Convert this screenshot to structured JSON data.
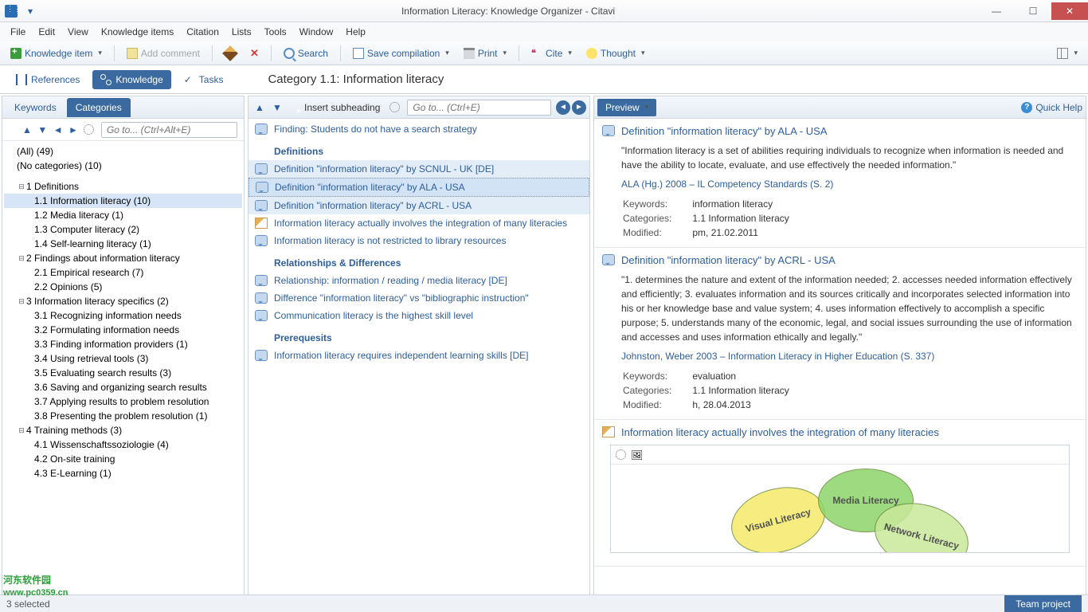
{
  "window": {
    "title": "Information Literacy: Knowledge Organizer - Citavi"
  },
  "menu": [
    "File",
    "Edit",
    "View",
    "Knowledge items",
    "Citation",
    "Lists",
    "Tools",
    "Window",
    "Help"
  ],
  "toolbar": {
    "knowledge_item": "Knowledge item",
    "add_comment": "Add comment",
    "search": "Search",
    "save_compilation": "Save compilation",
    "print": "Print",
    "cite": "Cite",
    "thought": "Thought"
  },
  "nav": {
    "references": "References",
    "knowledge": "Knowledge",
    "tasks": "Tasks",
    "crumb": "Category 1.1:  Information literacy"
  },
  "left": {
    "tabs": {
      "keywords": "Keywords",
      "categories": "Categories"
    },
    "goto_ph": "Go to... (Ctrl+Alt+E)",
    "all": "(All) (49)",
    "nocat": "(No categories) (10)",
    "tree": [
      {
        "lvl": 1,
        "tw": "⊟",
        "txt": "1 Definitions"
      },
      {
        "lvl": 2,
        "txt": "1.1 Information literacy (10)",
        "sel": true
      },
      {
        "lvl": 2,
        "txt": "1.2 Media literacy (1)"
      },
      {
        "lvl": 2,
        "txt": "1.3 Computer literacy (2)"
      },
      {
        "lvl": 2,
        "txt": "1.4 Self-learning literacy (1)"
      },
      {
        "lvl": 1,
        "tw": "⊟",
        "txt": "2 Findings about information literacy"
      },
      {
        "lvl": 2,
        "txt": "2.1 Empirical research (7)"
      },
      {
        "lvl": 2,
        "txt": "2.2 Opinions (5)"
      },
      {
        "lvl": 1,
        "tw": "⊟",
        "txt": "3 Information literacy specifics (2)"
      },
      {
        "lvl": 2,
        "txt": "3.1 Recognizing information needs"
      },
      {
        "lvl": 2,
        "txt": "3.2 Formulating information needs"
      },
      {
        "lvl": 2,
        "txt": "3.3 Finding information providers (1)"
      },
      {
        "lvl": 2,
        "txt": "3.4 Using retrieval tools (3)"
      },
      {
        "lvl": 2,
        "txt": "3.5 Evaluating search results (3)"
      },
      {
        "lvl": 2,
        "txt": "3.6 Saving and organizing search results"
      },
      {
        "lvl": 2,
        "txt": "3.7 Applying results to problem resolution"
      },
      {
        "lvl": 2,
        "txt": "3.8 Presenting the problem resolution (1)"
      },
      {
        "lvl": 1,
        "tw": "⊟",
        "txt": "4 Training methods (3)"
      },
      {
        "lvl": 2,
        "txt": "4.1 Wissenschaftssoziologie (4)"
      },
      {
        "lvl": 2,
        "txt": "4.2 On-site training"
      },
      {
        "lvl": 2,
        "txt": "4.3 E-Learning (1)"
      }
    ]
  },
  "mid": {
    "insert": "Insert subheading",
    "goto_ph": "Go to... (Ctrl+E)",
    "items": [
      {
        "ico": "quote",
        "txt": "Finding: Students do not have a search strategy"
      },
      {
        "head": "Definitions"
      },
      {
        "ico": "quote",
        "txt": "Definition \"information literacy\" by SCNUL - UK [DE]",
        "hl": true
      },
      {
        "ico": "quote",
        "txt": "Definition \"information literacy\" by ALA - USA",
        "sel": true
      },
      {
        "ico": "quote",
        "txt": "Definition \"information literacy\" by ACRL - USA",
        "hl": true
      },
      {
        "ico": "pen",
        "txt": "Information literacy actually involves the integration of many literacies"
      },
      {
        "ico": "quote",
        "txt": "Information literacy is not restricted to library resources"
      },
      {
        "head": "Relationships & Differences"
      },
      {
        "ico": "quote",
        "txt": "Relationship: information / reading / media literacy [DE]"
      },
      {
        "ico": "quote",
        "txt": "Difference \"information literacy\" vs \"bibliographic instruction\""
      },
      {
        "ico": "quote",
        "txt": "Communication literacy is the highest skill level"
      },
      {
        "head": "Prerequesits"
      },
      {
        "ico": "quote",
        "txt": "Information literacy requires independent learning skills [DE]"
      }
    ]
  },
  "right": {
    "preview": "Preview",
    "quickhelp": "Quick Help",
    "blocks": [
      {
        "ico": "quote",
        "title": "Definition \"information literacy\" by ALA - USA",
        "body": "\"Information literacy is a set of abilities requiring individuals to recognize when information is needed and have the ability to locate, evaluate, and use effectively the needed information.\"",
        "cite": "ALA (Hg.) 2008 – IL Competency Standards (S. 2)",
        "meta": [
          [
            "Keywords:",
            "information literacy"
          ],
          [
            "Categories:",
            "1.1 Information literacy"
          ],
          [
            "Modified:",
            "pm, 21.02.2011"
          ]
        ]
      },
      {
        "ico": "quote",
        "title": "Definition \"information literacy\" by ACRL - USA",
        "body": "\"1. determines the nature and extent of the information needed;\n2. accesses needed information effectively and efficiently;\n3. evaluates information and its sources critically and incorporates selected information into his or her knowledge base and value system;\n4. uses information effectively to accomplish a specific purpose;\n5. understands many of the economic, legal, and social issues surrounding the use of information and accesses and uses information ethically and legally.\"",
        "cite": "Johnston, Weber 2003 – Information Literacy in Higher Education (S. 337)",
        "meta": [
          [
            "Keywords:",
            "evaluation"
          ],
          [
            "Categories:",
            "1.1 Information literacy"
          ],
          [
            "Modified:",
            "h, 28.04.2013"
          ]
        ]
      },
      {
        "ico": "pen",
        "title": "Information literacy actually involves the integration of many literacies",
        "img": true
      }
    ],
    "venn": {
      "visual": "Visual Literacy",
      "media": "Media Literacy",
      "network": "Network Literacy"
    }
  },
  "status": {
    "selected": "3 selected",
    "team": "Team project"
  },
  "wm": {
    "a": "河东软件园",
    "b": "www.pc0359.cn"
  }
}
